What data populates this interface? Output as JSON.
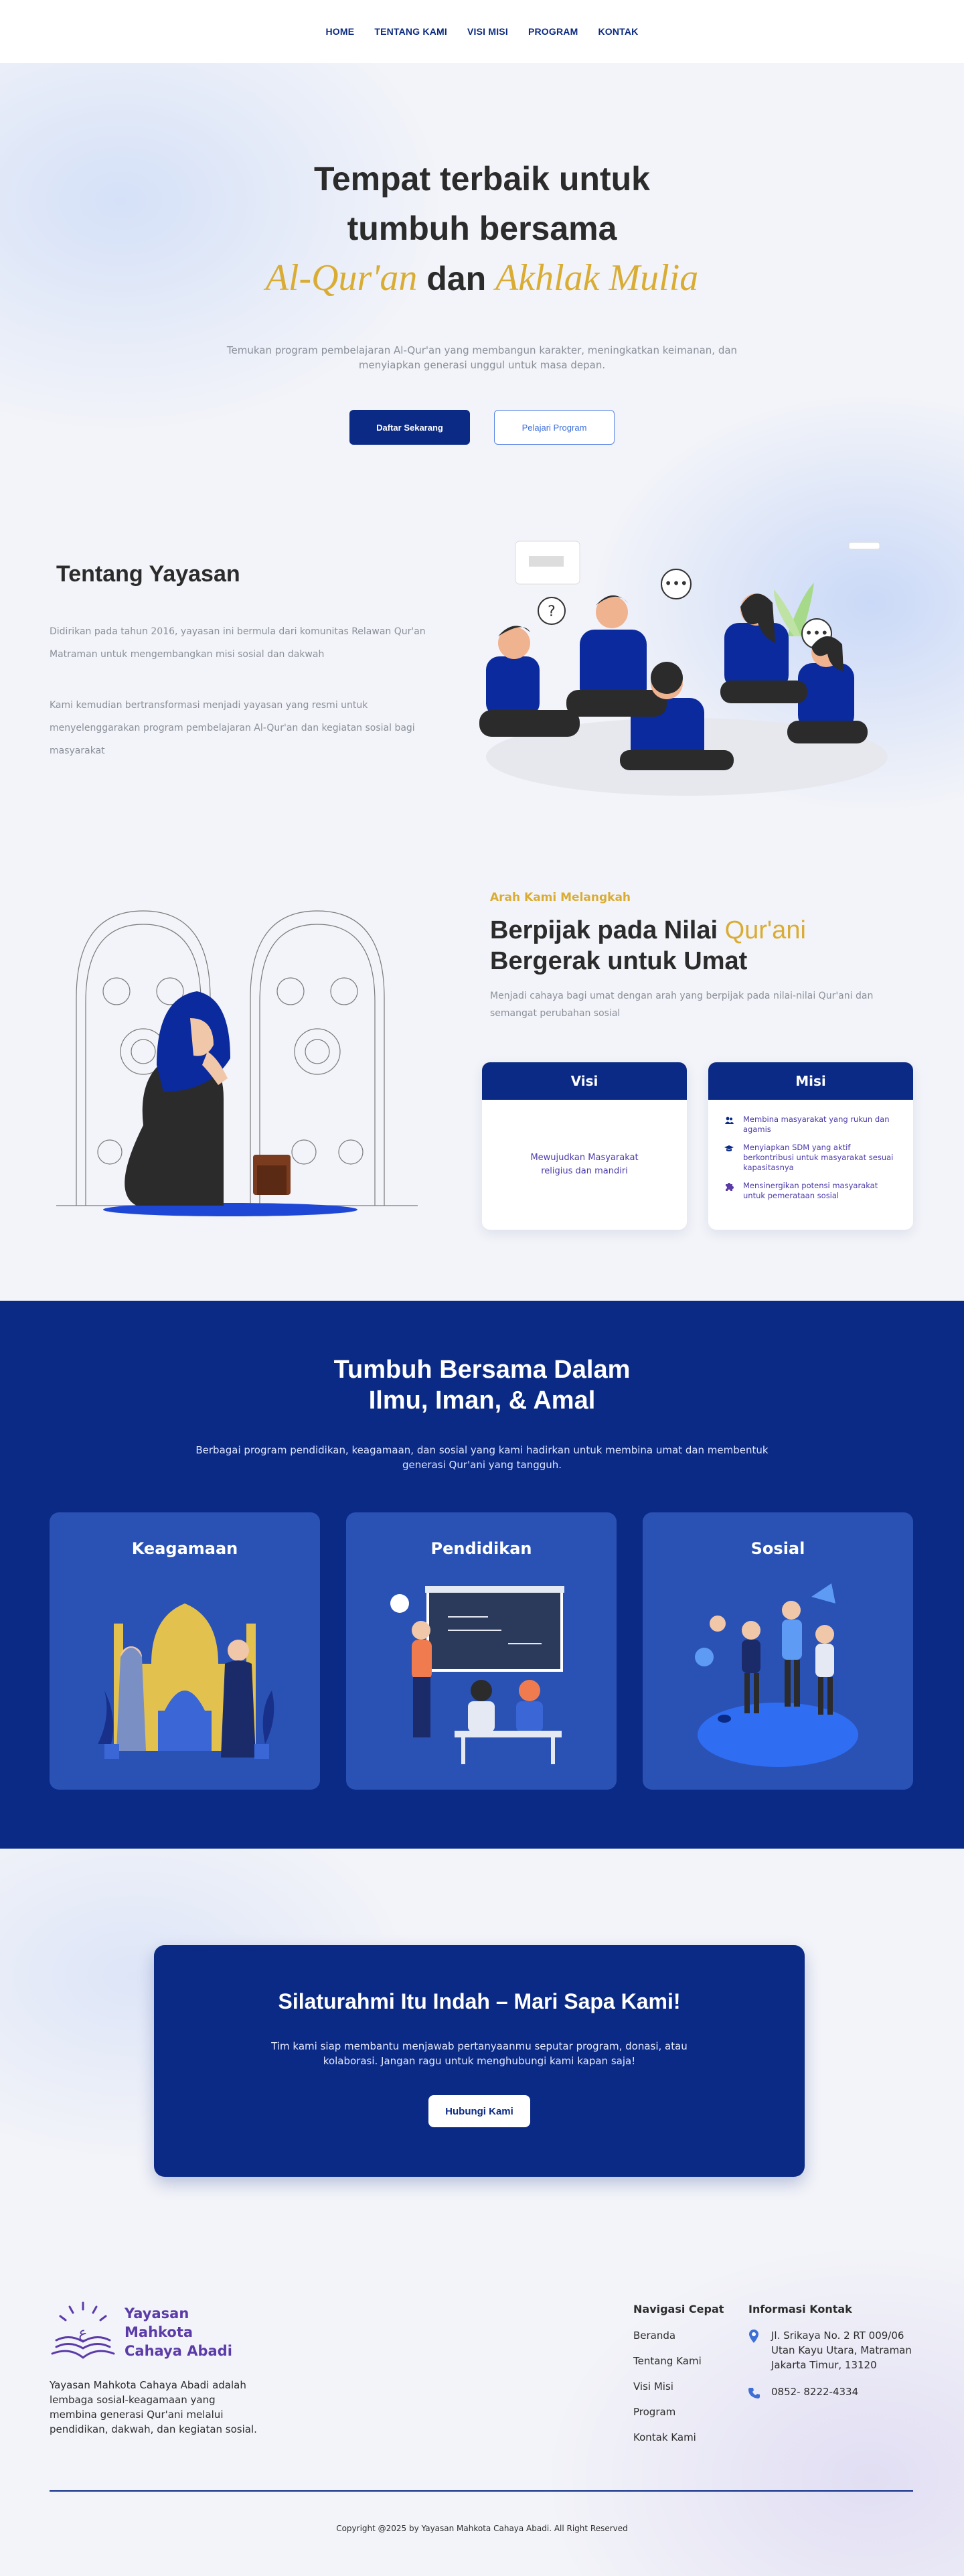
{
  "nav": {
    "items": [
      "HOME",
      "TENTANG KAMI",
      "VISI MISI",
      "PROGRAM",
      "KONTAK"
    ]
  },
  "hero": {
    "title_line1": "Tempat terbaik untuk",
    "title_line2": "tumbuh bersama",
    "title_script1": "Al-Qur'an",
    "title_connector": "dan",
    "title_script2": "Akhlak Mulia",
    "subtitle": "Temukan program pembelajaran Al-Qur'an yang membangun karakter, meningkatkan keimanan, dan menyiapkan generasi unggul untuk masa depan.",
    "primary_button": "Daftar Sekarang",
    "secondary_button": "Pelajari Program"
  },
  "about": {
    "title": "Tentang Yayasan",
    "paragraph1": "Didirikan pada tahun 2016, yayasan ini bermula dari komunitas Relawan Qur'an Matraman untuk mengembangkan misi sosial dan dakwah",
    "paragraph2": "Kami kemudian bertransformasi menjadi yayasan yang resmi untuk menyelenggarakan program pembelajaran Al-Qur'an dan kegiatan sosial bagi masyarakat"
  },
  "vision": {
    "eyebrow": "Arah Kami Melangkah",
    "title_part1": "Berpijak pada Nilai",
    "title_gold": "Qur'ani",
    "title_line2": "Bergerak untuk Umat",
    "subtitle": "Menjadi cahaya bagi umat dengan arah yang berpijak pada nilai-nilai Qur'ani dan semangat perubahan sosial",
    "visi_title": "Visi",
    "visi_text": "Mewujudkan Masyarakat religius dan mandiri",
    "misi_title": "Misi",
    "misi_items": [
      {
        "icon": "people-icon",
        "text": "Membina masyarakat yang rukun dan agamis"
      },
      {
        "icon": "graduation-cap-icon",
        "text": "Menyiapkan SDM yang aktif berkontribusi untuk masyarakat sesuai kapasitasnya"
      },
      {
        "icon": "puzzle-icon",
        "text": "Mensinergikan potensi masyarakat untuk pemerataan sosial"
      }
    ]
  },
  "programs": {
    "title_line1": "Tumbuh Bersama Dalam",
    "title_line2": "Ilmu, Iman, & Amal",
    "subtitle": "Berbagai program pendidikan, keagamaan, dan sosial yang kami hadirkan untuk membina umat dan membentuk generasi Qur'ani yang tangguh.",
    "cards": [
      "Keagamaan",
      "Pendidikan",
      "Sosial"
    ]
  },
  "cta": {
    "title": "Silaturahmi Itu Indah – Mari Sapa Kami!",
    "subtitle": "Tim kami siap membantu menjawab pertanyaanmu seputar program, donasi, atau kolaborasi. Jangan ragu untuk menghubungi kami kapan saja!",
    "button": "Hubungi Kami"
  },
  "footer": {
    "brand_line1": "Yayasan",
    "brand_line2": "Mahkota",
    "brand_line3": "Cahaya Abadi",
    "description": "Yayasan Mahkota Cahaya Abadi adalah lembaga sosial-keagamaan yang membina generasi Qur'ani melalui pendidikan, dakwah, dan kegiatan sosial.",
    "nav_title": "Navigasi Cepat",
    "nav_links": [
      "Beranda",
      "Tentang Kami",
      "Visi Misi",
      "Program",
      "Kontak Kami"
    ],
    "contact_title": "Informasi Kontak",
    "address": "Jl. Srikaya No. 2 RT 009/06 Utan Kayu Utara, Matraman Jakarta Timur, 13120",
    "phone": "0852- 8222-4334",
    "copyright": "Copyright @2025 by Yayasan Mahkota Cahaya Abadi. All Right Reserved"
  },
  "colors": {
    "primary": "#0b2a85",
    "accent_gold": "#d9ac34",
    "card_blue": "#2a52b5",
    "brand_purple": "#5b3ba8"
  }
}
